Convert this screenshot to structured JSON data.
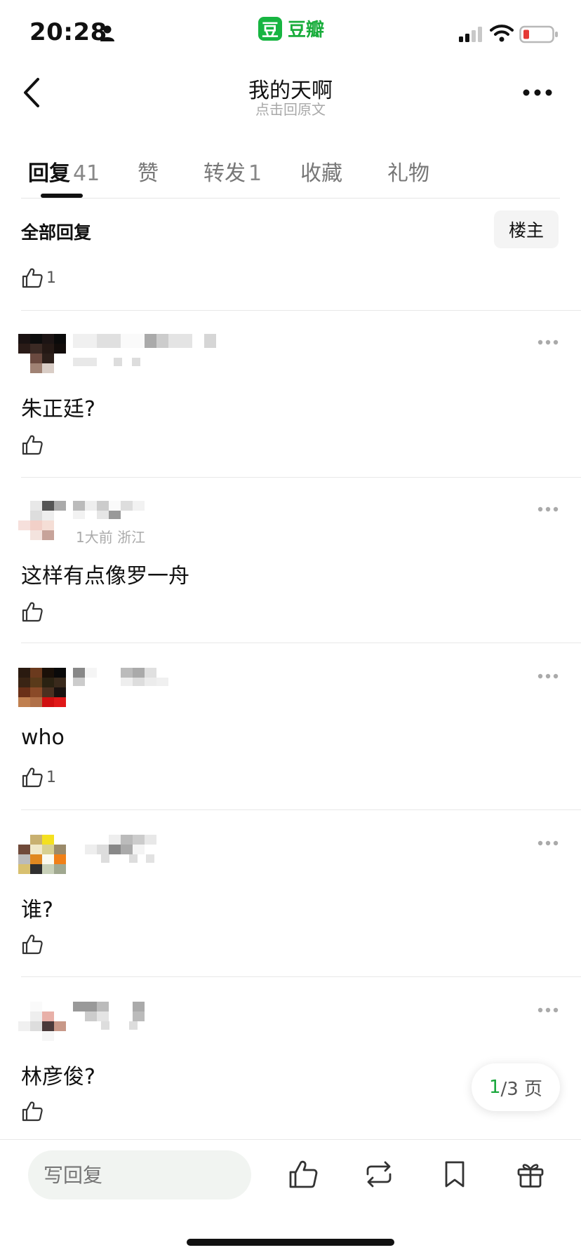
{
  "status_bar": {
    "time": "20:28",
    "app_name": "豆瓣",
    "app_logo_glyph": "豆"
  },
  "header": {
    "title": "我的天啊",
    "subtitle": "点击回原文"
  },
  "tabs": [
    {
      "label": "回复",
      "count": "41",
      "active": true
    },
    {
      "label": "赞",
      "count": ""
    },
    {
      "label": "转发",
      "count": "1"
    },
    {
      "label": "收藏",
      "count": ""
    },
    {
      "label": "礼物",
      "count": ""
    }
  ],
  "list_header": {
    "title": "全部回复",
    "op_button": "楼主"
  },
  "top_like_count": "1",
  "comments": [
    {
      "meta": "",
      "text": "朱正廷?",
      "likes": ""
    },
    {
      "meta": "1大前 浙江",
      "text": "这样有点像罗一舟",
      "likes": ""
    },
    {
      "meta": "",
      "text": "who",
      "likes": "1"
    },
    {
      "meta": "",
      "text": "谁?",
      "likes": ""
    },
    {
      "meta": "",
      "text": "林彦俊?",
      "likes": ""
    }
  ],
  "pager": {
    "current": "1",
    "total_text": "/3 页"
  },
  "bottom_bar": {
    "reply_placeholder": "写回复"
  },
  "colors": {
    "accent_green": "#18a63b",
    "battery_low": "#e53935"
  }
}
